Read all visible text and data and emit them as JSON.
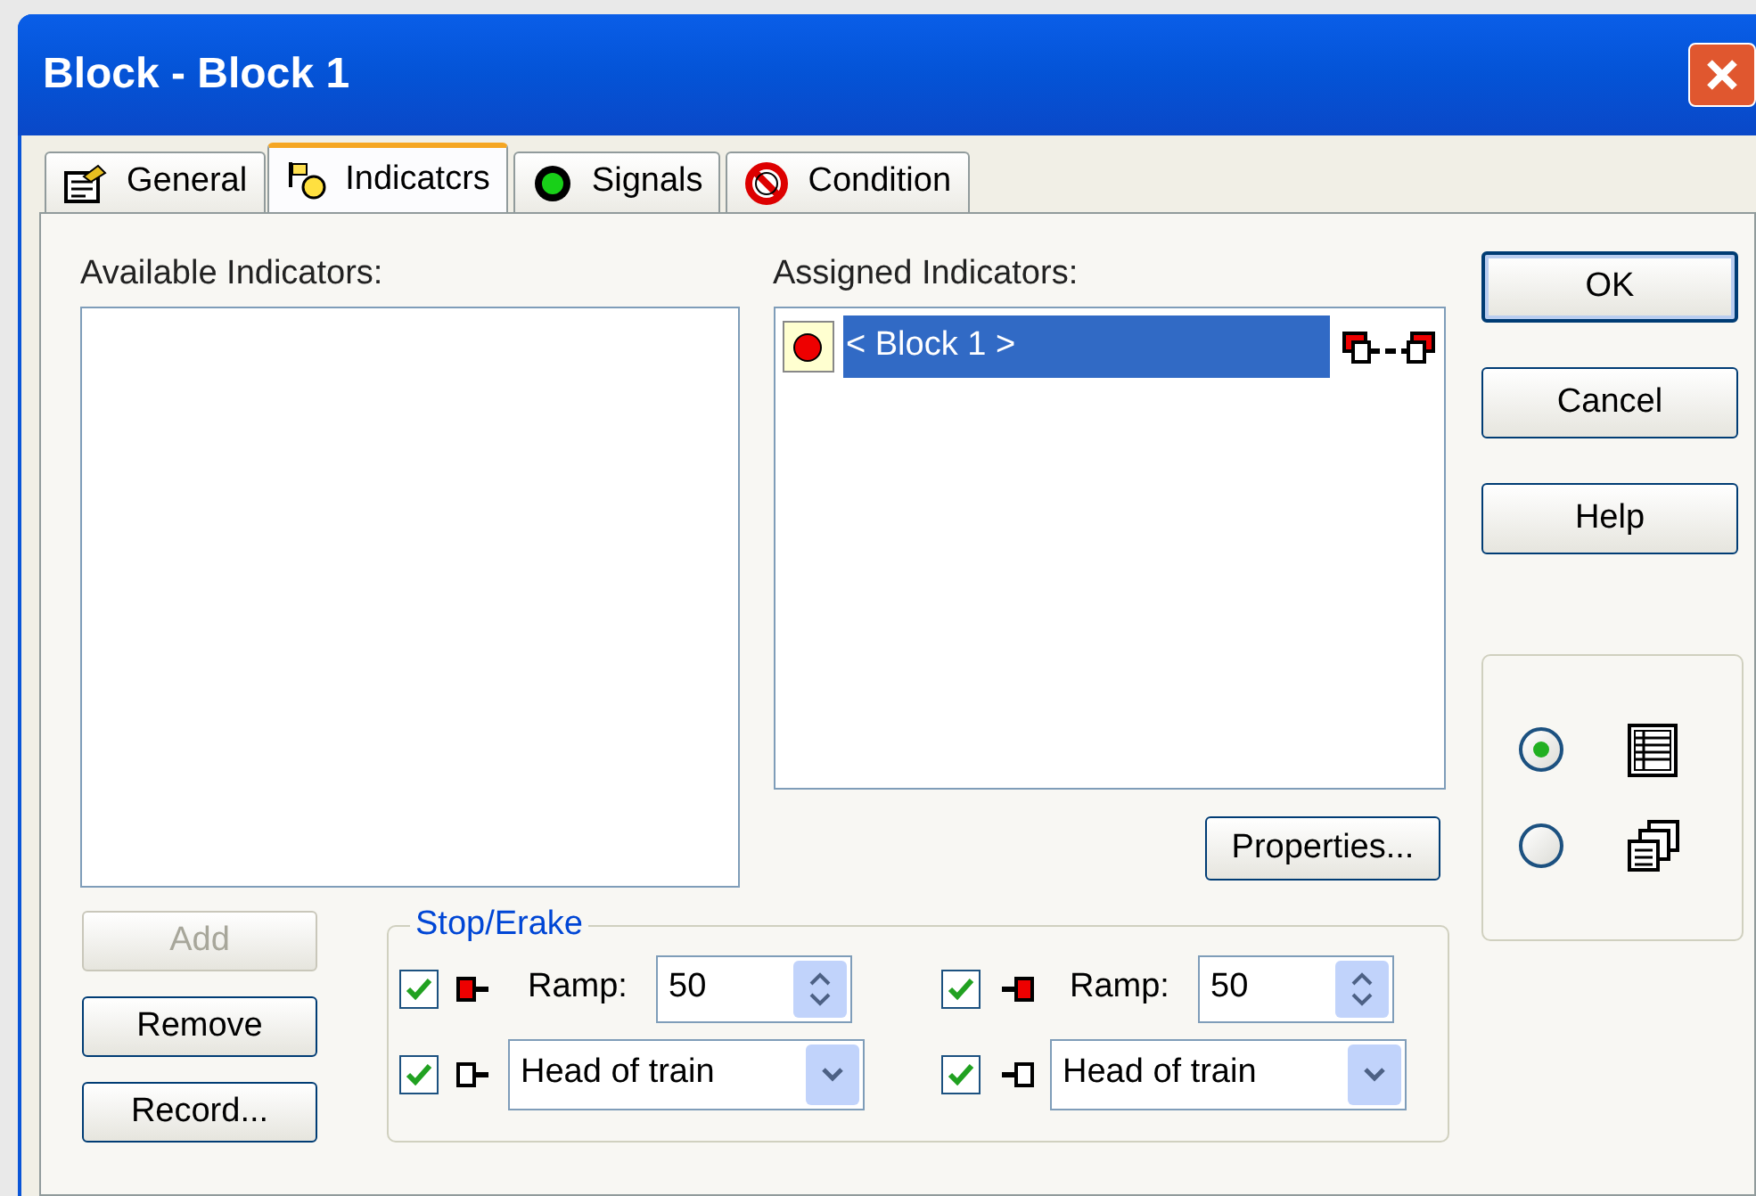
{
  "window": {
    "title": "Block - Block 1"
  },
  "tabs": [
    {
      "label": "General",
      "selected": false
    },
    {
      "label": "Indicatcrs",
      "selected": true
    },
    {
      "label": "Signals",
      "selected": false
    },
    {
      "label": "Condition",
      "selected": false
    }
  ],
  "available_indicators": {
    "label": "Available Indicators:"
  },
  "assigned_indicators": {
    "label": "Assigned Indicators:",
    "items": [
      {
        "text": "< Block 1 >",
        "selected": true
      }
    ]
  },
  "properties_button": {
    "label": "Properties..."
  },
  "list_buttons": [
    {
      "label": "Add",
      "disabled": true
    },
    {
      "label": "Remove",
      "disabled": false
    },
    {
      "label": "Record...",
      "disabled": false
    }
  ],
  "dialog_buttons": [
    {
      "label": "OK",
      "default": true
    },
    {
      "label": "Cancel",
      "default": false
    },
    {
      "label": "Help",
      "default": false
    }
  ],
  "view_options": [
    {
      "selected": true
    },
    {
      "selected": false
    }
  ],
  "stop_brake": {
    "title": "Stop/Erake",
    "items": [
      {
        "kind": "ramp",
        "checked": true,
        "label": "Ramp:",
        "value": "50"
      },
      {
        "kind": "ramp",
        "checked": true,
        "label": "Ramp:",
        "value": "50"
      },
      {
        "kind": "select",
        "checked": true,
        "value": "Head of train"
      },
      {
        "kind": "select",
        "checked": true,
        "value": "Head of train"
      }
    ]
  }
}
